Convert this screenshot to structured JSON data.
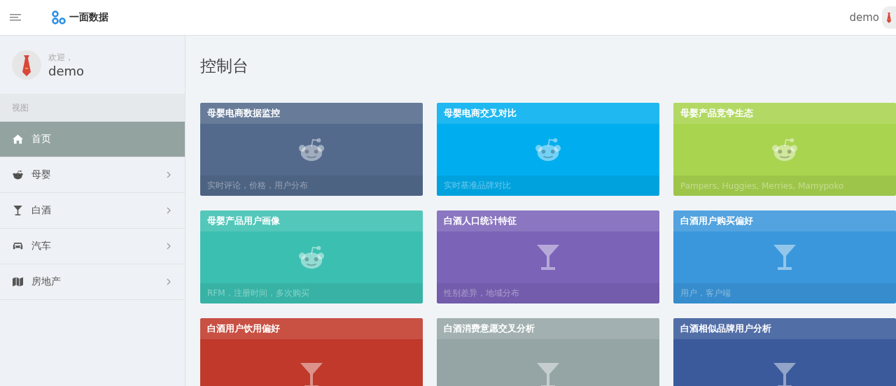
{
  "header": {
    "brand": "一面数据",
    "user": "demo"
  },
  "sidebar": {
    "greeting": "欢迎，",
    "user": "demo",
    "section": "视图",
    "items": [
      {
        "label": "首页",
        "kind": "home",
        "selected": true,
        "expandable": false
      },
      {
        "label": "母婴",
        "kind": "alien",
        "selected": false,
        "expandable": true
      },
      {
        "label": "白酒",
        "kind": "glass",
        "selected": false,
        "expandable": true
      },
      {
        "label": "汽车",
        "kind": "car",
        "selected": false,
        "expandable": true
      },
      {
        "label": "房地产",
        "kind": "map",
        "selected": false,
        "expandable": true
      }
    ]
  },
  "page_title": "控制台",
  "cards": [
    {
      "title": "母婴电商数据监控",
      "kind": "alien",
      "color": "#536a8c",
      "footer": "实时评论，价格，用户分布"
    },
    {
      "title": "母婴电商交叉对比",
      "kind": "alien",
      "color": "#00aeef",
      "footer": "实时基准品牌对比"
    },
    {
      "title": "母婴产品竞争生态",
      "kind": "alien",
      "color": "#a9d44f",
      "footer": "Pampers, Huggies, Merries, Mamypoko"
    },
    {
      "title": "母婴产品用户画像",
      "kind": "alien",
      "color": "#3bbfb1",
      "footer": "RFM，注册时间，多次购买"
    },
    {
      "title": "白酒人口统计特征",
      "kind": "glass",
      "color": "#7b63b8",
      "footer": "性别差异，地域分布"
    },
    {
      "title": "白酒用户购买偏好",
      "kind": "glass",
      "color": "#3a97db",
      "footer": "用户，客户端"
    },
    {
      "title": "白酒用户饮用偏好",
      "kind": "glass",
      "color": "#c0392b"
    },
    {
      "title": "白酒消费意愿交叉分析",
      "kind": "glass",
      "color": "#95a5a6"
    },
    {
      "title": "白酒相似品牌用户分析",
      "kind": "glass",
      "color": "#3a5a9b"
    }
  ]
}
